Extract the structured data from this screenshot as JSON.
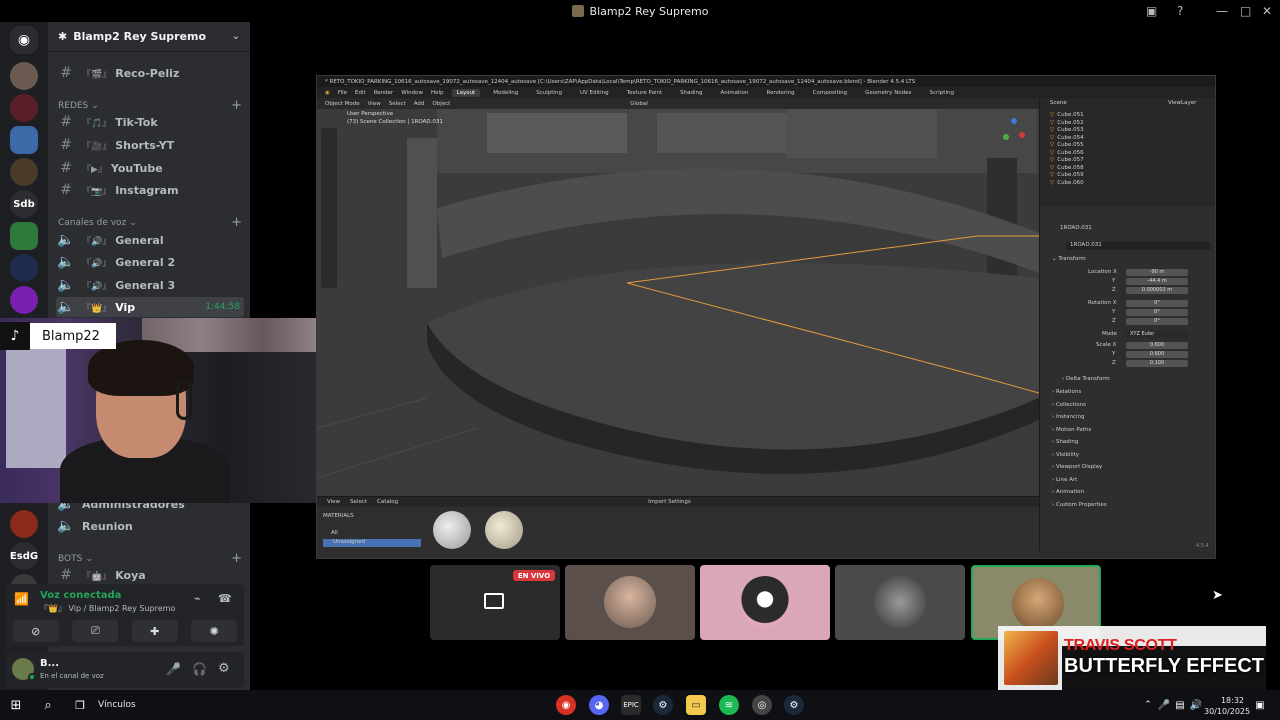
{
  "window": {
    "title": "Blamp2 Rey Supremo"
  },
  "server": {
    "name": "Blamp2 Rey Supremo"
  },
  "rail": {
    "items": [
      "",
      "",
      "",
      "",
      "",
      "Sdb",
      "",
      "",
      "",
      "",
      "",
      "EsdG",
      ""
    ]
  },
  "channels": {
    "top_channel": {
      "emoji": "『🎬』",
      "name": "Reco-Peliz"
    },
    "category_redes": "REDES",
    "redes": [
      {
        "emoji": "『🎵』",
        "name": "Tik-Tok"
      },
      {
        "emoji": "『🎥』",
        "name": "Shorts-YT"
      },
      {
        "emoji": "『▶』",
        "name": "YouTube"
      },
      {
        "emoji": "『📷』",
        "name": "Instagram"
      }
    ],
    "category_voz": "Canales de voz",
    "voice": [
      {
        "emoji": "『🔊』",
        "name": "General"
      },
      {
        "emoji": "『🔊』",
        "name": "General 2"
      },
      {
        "emoji": "『🔊』",
        "name": "General 3"
      }
    ],
    "vip": {
      "emoji": "『👑』",
      "name": "Vip",
      "timer": "1:44:58"
    },
    "hidden_channel": "Administradores",
    "reunion": "Reunion",
    "category_bots": "BOTS",
    "bot_channel": {
      "emoji": "『🤖』",
      "name": "Koya"
    }
  },
  "voice_panel": {
    "status": "Voz conectada",
    "location": "『👑』 Vip / Blamp2 Rey Supremo"
  },
  "user": {
    "name": "B...",
    "status": "En el canal de voz"
  },
  "webcam": {
    "platform": "TikTok",
    "username": "Blamp22"
  },
  "blender": {
    "title": "* RETO_TOKIO_PARKING_10616_autosave_19072_autosave_12404_autosave [C:\\Users\\ZAP\\AppData\\Local\\Temp\\RETO_TOKIO_PARKING_10616_autosave_19072_autosave_12404_autosave.blend] - Blender 4.5.4 LTS",
    "menu": [
      "File",
      "Edit",
      "Render",
      "Window",
      "Help"
    ],
    "workspaces": [
      "Layout",
      "Modeling",
      "Sculpting",
      "UV Editing",
      "Texture Paint",
      "Shading",
      "Animation",
      "Rendering",
      "Compositing",
      "Geometry Nodes",
      "Scripting"
    ],
    "active_workspace": "Layout",
    "header": [
      "Object Mode",
      "View",
      "Select",
      "Add",
      "Object",
      "Global"
    ],
    "overlay_lines": [
      "User Perspective",
      "(73) Scene Collection | 1ROAD.031"
    ],
    "outliner": {
      "title": "Scene",
      "viewlayer": "ViewLayer",
      "items": [
        "Cube.051",
        "Cube.052",
        "Cube.053",
        "Cube.054",
        "Cube.055",
        "Cube.056",
        "Cube.057",
        "Cube.058",
        "Cube.059",
        "Cube.060"
      ]
    },
    "properties": {
      "object_name": "1ROAD.031",
      "panel": "Transform",
      "location": {
        "label": "Location X",
        "x": "-90 m",
        "y": "-44.4 m",
        "z": "0.000002 m"
      },
      "rotation": {
        "label": "Rotation X",
        "x": "0°",
        "y": "0°",
        "z": "0°"
      },
      "mode_label": "Mode",
      "mode": "XYZ Euler",
      "scale": {
        "label": "Scale X",
        "x": "0.600",
        "y": "0.600",
        "z": "0.100"
      },
      "sections": [
        "Delta Transform",
        "Relations",
        "Collections",
        "Instancing",
        "Motion Paths",
        "Shading",
        "Visibility",
        "Viewport Display",
        "Line Art",
        "Animation",
        "Custom Properties"
      ]
    },
    "asset": {
      "menu": [
        "View",
        "Select",
        "Catalog"
      ],
      "import": "Import Settings",
      "library": "MATERIALS",
      "all": "All",
      "unassigned": "Unassigned"
    },
    "version": "4.5.4"
  },
  "stream": {
    "live_label": "EN VIVO"
  },
  "now_playing": {
    "artist": "TRAVIS SCOTT",
    "song": "BUTTERFLY EFFECT"
  },
  "taskbar": {
    "links": "Vínculos",
    "time": "18:32",
    "date": "30/10/2025"
  },
  "colors": {
    "discord_bg": "#2b2d31",
    "rail_bg": "#1e1f22",
    "accent_green": "#23a55a",
    "live_red": "#da373c",
    "blender_selection": "#e69b3c"
  }
}
